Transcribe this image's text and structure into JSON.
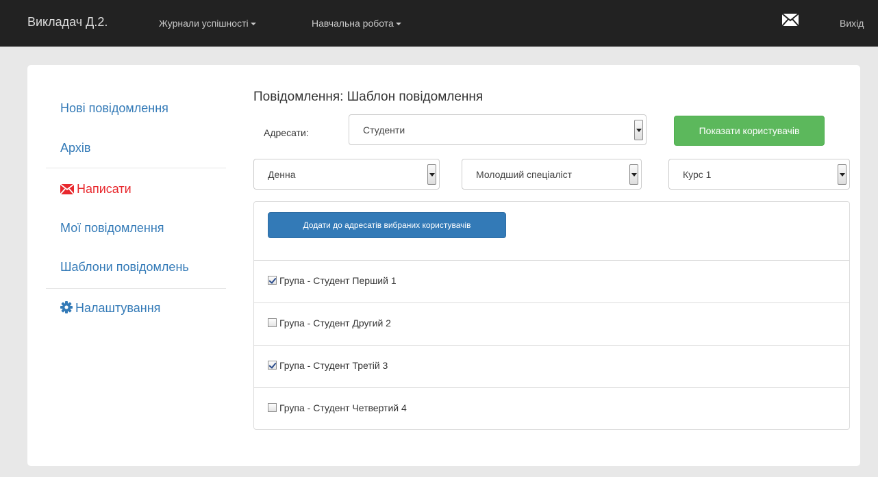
{
  "navbar": {
    "brand": "Викладач Д.2.",
    "menu_journals": "Журнали успішності",
    "menu_study": "Навчальна робота",
    "logout": "Вихід",
    "envelope_icon": "envelope-icon"
  },
  "sidebar": {
    "items": [
      {
        "label": "Нові повідомлення"
      },
      {
        "label": "Архів"
      },
      {
        "label": "Написати",
        "icon": "envelope-icon",
        "active": true
      },
      {
        "label": "Мої повідомлення"
      },
      {
        "label": "Шаблони повідомлень"
      },
      {
        "label": "Налаштування",
        "icon": "gear-icon"
      }
    ]
  },
  "main": {
    "title": "Повідомлення: Шаблон повідомлення",
    "recipients_label": "Адресати:",
    "recipients_value": "Студенти",
    "show_users_button": "Показати користувачів",
    "filters": {
      "form": "Денна",
      "level": "Молодший спеціаліст",
      "course": "Курс 1"
    },
    "add_button": "Додати до адресатів вибраних користувачів",
    "students": [
      {
        "label": "Група - Студент Перший 1",
        "checked": true
      },
      {
        "label": "Група - Студент Другий 2",
        "checked": false
      },
      {
        "label": "Група - Студент Третій 3",
        "checked": true
      },
      {
        "label": "Група - Студент Четвертий 4",
        "checked": false
      }
    ]
  },
  "colors": {
    "navbar_bg": "#222222",
    "link": "#337ab7",
    "active": "#e8282d",
    "success": "#5cb85c",
    "primary": "#337ab7"
  }
}
